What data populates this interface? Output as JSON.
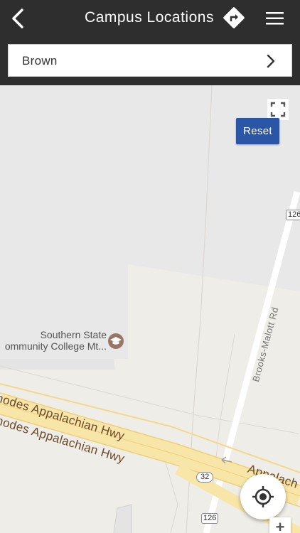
{
  "header": {
    "title": "Campus Locations",
    "back_icon": "chevron-left-icon",
    "directions_icon": "directions-icon",
    "menu_icon": "hamburger-menu-icon"
  },
  "selector": {
    "label": "Brown",
    "icon": "chevron-right-icon"
  },
  "map": {
    "reset_label": "Reset",
    "fullscreen_icon": "fullscreen-icon",
    "locate_icon": "my-location-icon",
    "zoom_in_label": "+",
    "poi": {
      "name_line1": "Southern State",
      "name_line2": "ommunity College Mt...",
      "icon": "graduation-cap-icon"
    },
    "roads": {
      "hwy_label_1": "hodes Appalachian Hwy",
      "hwy_label_2": "hodes Appalachian Hwy",
      "hwy_label_3": "Appalach",
      "street_label": "Brooks-Malott Rd",
      "shield_126_top": "126",
      "shield_32": "32",
      "shield_126_bottom": "126"
    }
  },
  "colors": {
    "header_bg": "#2e2e2e",
    "reset_bg": "#2b56a6",
    "map_bg": "#e8e8e8",
    "campus_area": "#efede7",
    "highway": "#f8e6a8"
  }
}
